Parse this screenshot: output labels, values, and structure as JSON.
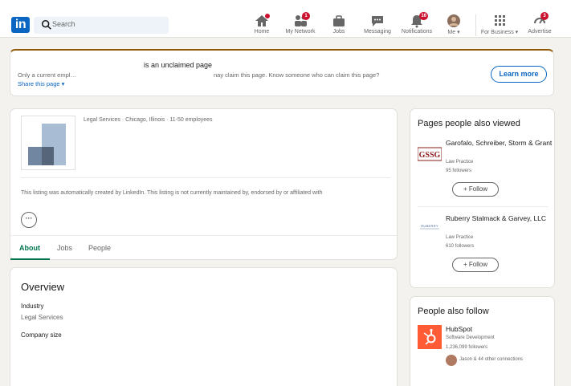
{
  "nav": {
    "logo_text": "in",
    "search_placeholder": "Search",
    "items": [
      {
        "label": "Home",
        "icon": "home-icon",
        "badge": ""
      },
      {
        "label": "My Network",
        "icon": "network-icon",
        "badge": "1"
      },
      {
        "label": "Jobs",
        "icon": "briefcase-icon",
        "badge": ""
      },
      {
        "label": "Messaging",
        "icon": "messaging-icon",
        "badge": ""
      },
      {
        "label": "Notifications",
        "icon": "bell-icon",
        "badge": "16"
      },
      {
        "label": "Me ▾",
        "icon": "avatar",
        "badge": ""
      },
      {
        "label": "For Business ▾",
        "icon": "grid-icon",
        "badge": ""
      },
      {
        "label": "Advertise",
        "icon": "advertise-icon",
        "badge": "3"
      }
    ]
  },
  "banner": {
    "title": "is an unclaimed page",
    "left_text": "Only a current empl…",
    "right_text": "nay claim this page. Know someone who can claim this page?",
    "share": "Share this page",
    "learn_more": "Learn more"
  },
  "company": {
    "meta": "Legal Services · Chicago, Illinois · 11-50 employees",
    "listing_note": "This listing was automatically created by LinkedIn. This listing is not currently maintained by, endorsed by or affiliated with",
    "more_label": "···",
    "tabs": [
      "About",
      "Jobs",
      "People"
    ]
  },
  "overview": {
    "title": "Overview",
    "industry_label": "Industry",
    "industry_value": "Legal Services",
    "company_size_label": "Company size"
  },
  "pages_also_viewed": {
    "title": "Pages people also viewed",
    "items": [
      {
        "name": "Garofalo, Schreiber, Storm & Grant",
        "logo_text": "GSSG",
        "category": "Law Practice",
        "followers": "95 followers",
        "follow": "+ Follow"
      },
      {
        "name": "Ruberry Stalmack & Garvey, LLC",
        "logo_text": "RUBERRY",
        "category": "Law Practice",
        "followers": "610 followers",
        "follow": "+ Follow"
      }
    ]
  },
  "people_also_follow": {
    "title": "People also follow",
    "items": [
      {
        "name": "HubSpot",
        "category": "Software Development",
        "followers": "1,236,099 followers",
        "connections": "Jason & 44 other connections"
      }
    ]
  },
  "colors": {
    "brand": "#0a66c2",
    "accent_green": "#01754f",
    "banner_top": "#915907",
    "badge": "#cb112d",
    "hubspot": "#ff5c35"
  }
}
